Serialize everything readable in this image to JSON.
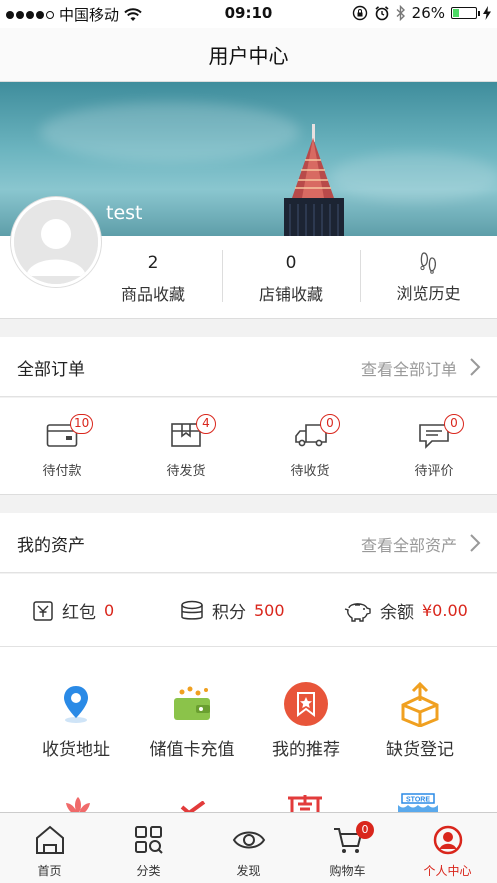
{
  "status_bar": {
    "carrier": "中国移动",
    "time": "09:10",
    "battery_percent": "26%",
    "battery_level": 0.26
  },
  "navbar": {
    "title": "用户中心"
  },
  "profile": {
    "username": "test",
    "stats": [
      {
        "value": "2",
        "label": "商品收藏"
      },
      {
        "value": "0",
        "label": "店铺收藏"
      },
      {
        "value": "",
        "label": "浏览历史",
        "icon": "footprint-icon"
      }
    ]
  },
  "orders": {
    "title": "全部订单",
    "view_all": "查看全部订单",
    "items": [
      {
        "label": "待付款",
        "badge": "10",
        "icon": "wallet-icon"
      },
      {
        "label": "待发货",
        "badge": "4",
        "icon": "package-icon"
      },
      {
        "label": "待收货",
        "badge": "0",
        "icon": "truck-icon"
      },
      {
        "label": "待评价",
        "badge": "0",
        "icon": "comment-icon"
      }
    ]
  },
  "assets": {
    "title": "我的资产",
    "view_all": "查看全部资产",
    "items": [
      {
        "label": "红包",
        "value": "0",
        "icon": "red-envelope-icon"
      },
      {
        "label": "积分",
        "value": "500",
        "icon": "coins-icon"
      },
      {
        "label": "余额",
        "value": "¥0.00",
        "icon": "piggy-bank-icon"
      }
    ]
  },
  "services": [
    {
      "label": "收货地址",
      "icon": "location-pin-icon"
    },
    {
      "label": "储值卡充值",
      "icon": "wallet-topup-icon"
    },
    {
      "label": "我的推荐",
      "icon": "recommend-icon"
    },
    {
      "label": "缺货登记",
      "icon": "box-upload-icon"
    }
  ],
  "tabbar": {
    "items": [
      {
        "label": "首页",
        "icon": "home-icon"
      },
      {
        "label": "分类",
        "icon": "category-icon"
      },
      {
        "label": "发现",
        "icon": "eye-icon"
      },
      {
        "label": "购物车",
        "icon": "cart-icon",
        "badge": "0"
      },
      {
        "label": "个人中心",
        "icon": "user-center-icon",
        "active": true
      }
    ]
  },
  "colors": {
    "accent": "#d9261c",
    "orange": "#f0a020",
    "blue": "#2a8ae6",
    "green": "#8bc34a"
  }
}
